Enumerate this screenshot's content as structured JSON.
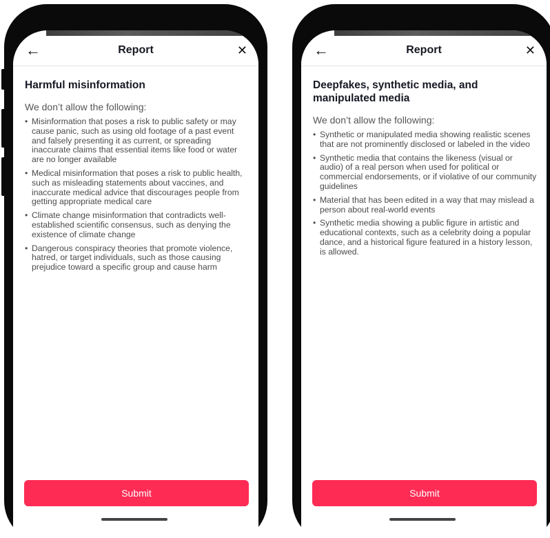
{
  "screens": [
    {
      "header": {
        "title": "Report",
        "back_icon": "arrow-left-icon",
        "close_icon": "close-icon"
      },
      "policy_title": "Harmful misinformation",
      "intro": "We don’t allow the following:",
      "items": [
        "Misinformation that poses a risk to public safety or may cause panic, such as using old footage of a past event and falsely presenting it as current, or spreading inaccurate claims that essential items like food or water are no longer available",
        "Medical misinformation that poses a risk to public health, such as misleading statements about vaccines, and inaccurate medical advice that discourages people from getting appropriate medical care",
        "Climate change misinformation that contradicts well-established scientific consensus, such as denying the existence of climate change",
        "Dangerous conspiracy theories that promote violence, hatred, or target individuals, such as those causing prejudice toward a specific group and cause harm"
      ],
      "submit_label": "Submit"
    },
    {
      "header": {
        "title": "Report",
        "back_icon": "arrow-left-icon",
        "close_icon": "close-icon"
      },
      "policy_title": "Deepfakes, synthetic media, and manipulated media",
      "intro": "We don’t allow the following:",
      "items": [
        "Synthetic or manipulated media showing realistic scenes that are not prominently disclosed or labeled in the video",
        "Synthetic media that contains the likeness (visual or audio) of a real person when used for political or commercial endorsements, or if violative of our community guidelines",
        "Material that has been edited in a way that may mislead a person about real-world events",
        "Synthetic media showing a public figure in artistic and educational contexts, such as a celebrity doing a popular dance, and a historical figure featured in a history lesson, is allowed."
      ],
      "submit_label": "Submit"
    }
  ],
  "colors": {
    "accent": "#fe2c55",
    "text_primary": "#161823",
    "text_secondary": "#4a4a4a"
  }
}
